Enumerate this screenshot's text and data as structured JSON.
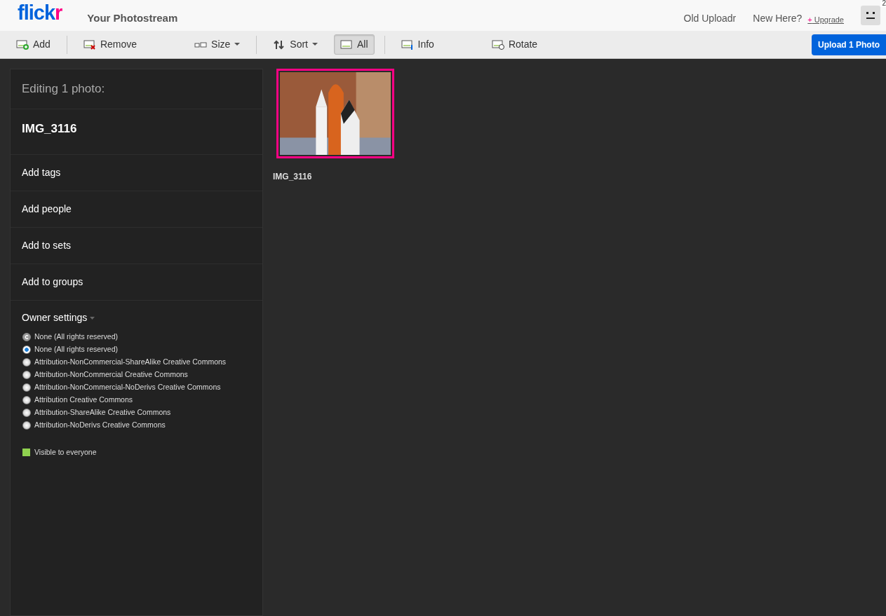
{
  "header": {
    "logo": {
      "main": "flick",
      "accent": "r"
    },
    "title": "Your Photostream",
    "links": [
      "Old Uploadr",
      "New Here?"
    ],
    "upgrade": {
      "mark": "+",
      "label": "Upgrade"
    },
    "avatar_badge": "2"
  },
  "toolbar": {
    "items": [
      {
        "label": "Add",
        "kind": "add",
        "dropdown": false,
        "selected": false,
        "divider_after": true
      },
      {
        "label": "Remove",
        "kind": "remove",
        "dropdown": false,
        "selected": false,
        "divider_after": false
      },
      {
        "label": "Size",
        "kind": "size",
        "dropdown": true,
        "selected": false,
        "divider_after": true
      },
      {
        "label": "Sort",
        "kind": "sort",
        "dropdown": true,
        "selected": false,
        "divider_after": false
      },
      {
        "label": "All",
        "kind": "all",
        "dropdown": false,
        "selected": true,
        "divider_after": true
      },
      {
        "label": "Info",
        "kind": "info",
        "dropdown": false,
        "selected": false,
        "divider_after": false
      },
      {
        "label": "Rotate",
        "kind": "rotate",
        "dropdown": false,
        "selected": false,
        "divider_after": false
      }
    ],
    "upload_button": "Upload 1 Photo"
  },
  "sidebar": {
    "heading": "Editing 1 photo:",
    "photo_title": "IMG_3116",
    "actions": [
      "Add tags",
      "Add people",
      "Add to sets",
      "Add to groups"
    ],
    "owner_settings": {
      "label": "Owner settings",
      "licenses": [
        {
          "label": "None (All rights reserved)",
          "kind": "copyright",
          "selected": false
        },
        {
          "label": "None (All rights reserved)",
          "kind": "radio",
          "selected": true
        },
        {
          "label": "Attribution-NonCommercial-ShareAlike Creative Commons",
          "kind": "radio",
          "selected": false
        },
        {
          "label": "Attribution-NonCommercial Creative Commons",
          "kind": "radio",
          "selected": false
        },
        {
          "label": "Attribution-NonCommercial-NoDerivs Creative Commons",
          "kind": "radio",
          "selected": false
        },
        {
          "label": "Attribution Creative Commons",
          "kind": "radio",
          "selected": false
        },
        {
          "label": "Attribution-ShareAlike Creative Commons",
          "kind": "radio",
          "selected": false
        },
        {
          "label": "Attribution-NoDerivs Creative Commons",
          "kind": "radio",
          "selected": false
        }
      ],
      "visibility": {
        "label": "Visible to everyone",
        "color": "#8fd14f"
      }
    }
  },
  "photos": [
    {
      "caption": "IMG_3116",
      "selected": true
    }
  ]
}
